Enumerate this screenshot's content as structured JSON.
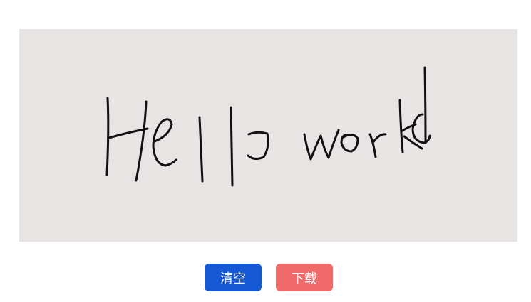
{
  "signature_pad": {
    "handwritten_text": "Hello world",
    "background_color": "#e8e4e4",
    "stroke_color": "#111111"
  },
  "actions": {
    "clear_label": "清空",
    "download_label": "下载",
    "clear_color": "#1558d6",
    "download_color": "#f06a6a"
  }
}
